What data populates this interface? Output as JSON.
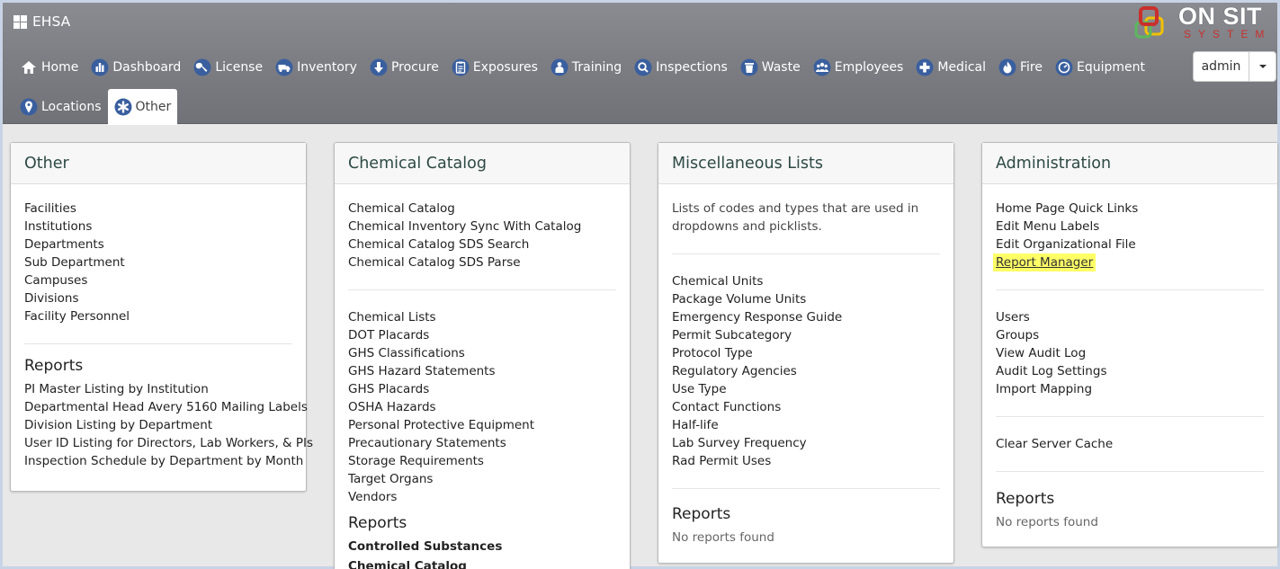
{
  "app": {
    "brand": "EHSA"
  },
  "logo": {
    "name": "ON SITE",
    "sub": "SYSTEMS",
    "visible_name": "ON SIT",
    "visible_sub": "SYSTEM"
  },
  "nav": {
    "items": [
      {
        "label": "Home",
        "icon": "home-icon"
      },
      {
        "label": "Dashboard",
        "icon": "bar-chart-icon"
      },
      {
        "label": "License",
        "icon": "wrench-icon"
      },
      {
        "label": "Inventory",
        "icon": "truck-icon"
      },
      {
        "label": "Procure",
        "icon": "arrow-down-icon"
      },
      {
        "label": "Exposures",
        "icon": "clipboard-icon"
      },
      {
        "label": "Training",
        "icon": "teacher-icon"
      },
      {
        "label": "Inspections",
        "icon": "search-icon"
      },
      {
        "label": "Waste",
        "icon": "trash-icon"
      },
      {
        "label": "Employees",
        "icon": "users-icon"
      },
      {
        "label": "Medical",
        "icon": "plus-icon"
      },
      {
        "label": "Fire",
        "icon": "fire-icon"
      },
      {
        "label": "Equipment",
        "icon": "gauge-icon"
      }
    ],
    "row2": [
      {
        "label": "Locations",
        "icon": "map-pin-icon"
      },
      {
        "label": "Other",
        "icon": "asterisk-icon",
        "active": true
      }
    ]
  },
  "user": {
    "label": "admin"
  },
  "panels": {
    "other": {
      "title": "Other",
      "links": [
        "Facilities",
        "Institutions",
        "Departments",
        "Sub Department",
        "Campuses",
        "Divisions",
        "Facility Personnel"
      ],
      "reports_title": "Reports",
      "reports": [
        "PI Master Listing by Institution",
        "Departmental Head Avery 5160 Mailing Labels",
        "Division Listing by Department",
        "User ID Listing for Directors, Lab Workers, & PIs",
        "Inspection Schedule by Department by Month"
      ]
    },
    "catalog": {
      "title": "Chemical Catalog",
      "links1": [
        "Chemical Catalog",
        "Chemical Inventory Sync With Catalog",
        "Chemical Catalog SDS Search",
        "Chemical Catalog SDS Parse"
      ],
      "links2": [
        "Chemical Lists",
        "DOT Placards",
        "GHS Classifications",
        "GHS Hazard Statements",
        "GHS Placards",
        "OSHA Hazards",
        "Personal Protective Equipment",
        "Precautionary Statements",
        "Storage Requirements",
        "Target Organs",
        "Vendors"
      ],
      "reports_title": "Reports",
      "report_group": "Controlled Substances",
      "report_group2": "Chemical Catalog"
    },
    "misc": {
      "title": "Miscellaneous Lists",
      "description": "Lists of codes and types that are used in dropdowns and picklists.",
      "links": [
        "Chemical Units",
        "Package Volume Units",
        "Emergency Response Guide",
        "Permit Subcategory",
        "Protocol Type",
        "Regulatory Agencies",
        "Use Type",
        "Contact Functions",
        "Half-life",
        "Lab Survey Frequency",
        "Rad Permit Uses"
      ],
      "reports_title": "Reports",
      "no_reports": "No reports found"
    },
    "admin": {
      "title": "Administration",
      "links1": [
        "Home Page Quick Links",
        "Edit Menu Labels",
        "Edit Organizational File"
      ],
      "highlighted_link": "Report Manager",
      "links2": [
        "Users",
        "Groups",
        "View Audit Log",
        "Audit Log Settings",
        "Import Mapping"
      ],
      "links3": [
        "Clear Server Cache"
      ],
      "reports_title": "Reports",
      "no_reports": "No reports found"
    }
  },
  "colors": {
    "header": "#7d7f85",
    "panel_title": "#2e4a45",
    "highlight": "#ffff66",
    "icon_bg": "#3a5f9e"
  }
}
